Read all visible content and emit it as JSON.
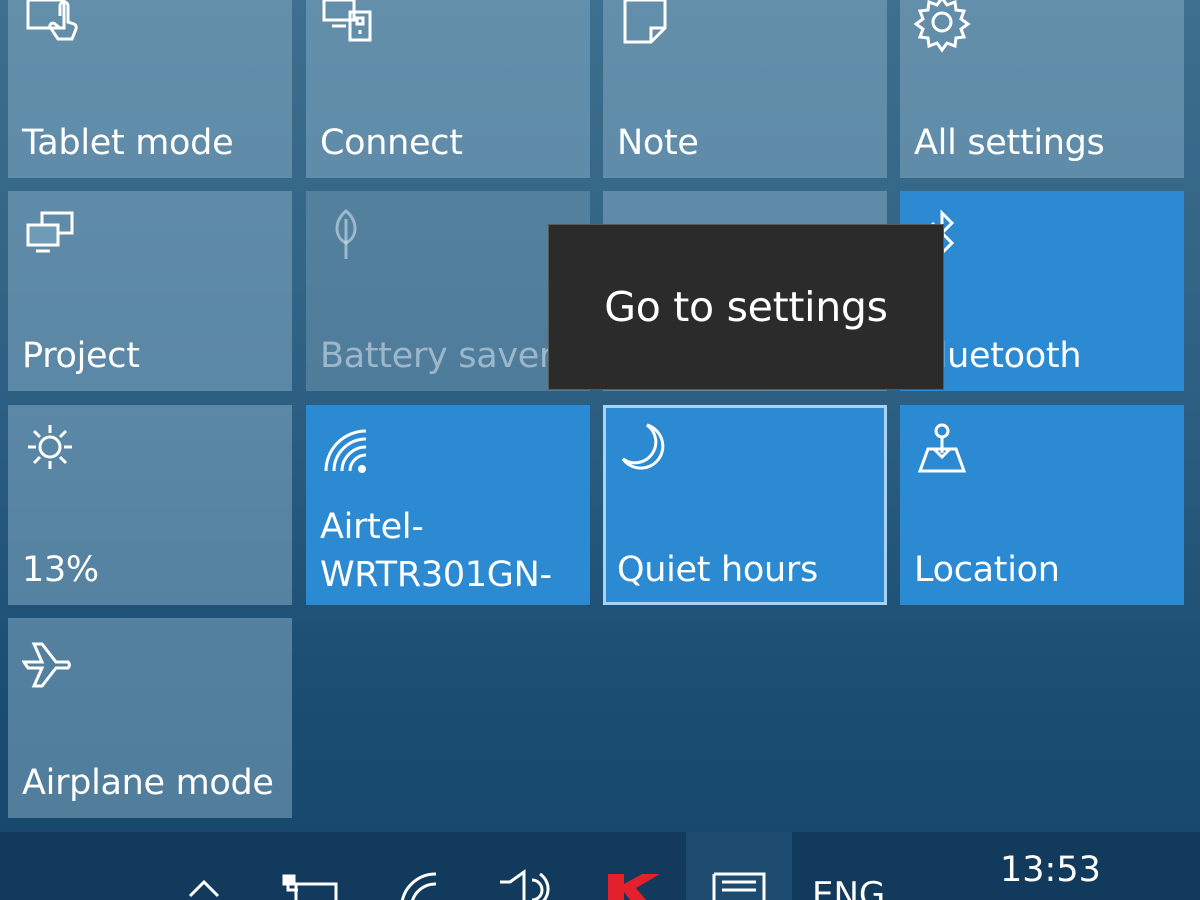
{
  "tiles": {
    "tablet_mode": {
      "label": "Tablet mode",
      "icon": "tablet-mode-icon",
      "state": "off"
    },
    "connect": {
      "label": "Connect",
      "icon": "connect-icon",
      "state": "off"
    },
    "note": {
      "label": "Note",
      "icon": "note-icon",
      "state": "off"
    },
    "all_settings": {
      "label": "All settings",
      "icon": "gear-icon",
      "state": "off"
    },
    "project": {
      "label": "Project",
      "icon": "project-icon",
      "state": "off"
    },
    "battery_saver": {
      "label": "Battery saver",
      "icon": "leaf-icon",
      "state": "disabled"
    },
    "bluetooth": {
      "label": "Bluetooth",
      "icon": "bluetooth-icon",
      "state": "on"
    },
    "brightness": {
      "label": "13%",
      "icon": "sun-icon",
      "state": "off"
    },
    "wifi": {
      "label": "Airtel-WRTR301GN-",
      "icon": "wifi-icon",
      "state": "on"
    },
    "quiet_hours": {
      "label": "Quiet hours",
      "icon": "moon-icon",
      "state": "on"
    },
    "location": {
      "label": "Location",
      "icon": "location-icon",
      "state": "on"
    },
    "airplane_mode": {
      "label": "Airplane mode",
      "icon": "airplane-icon",
      "state": "off"
    }
  },
  "tooltip": {
    "text": "Go to settings"
  },
  "taskbar": {
    "language": "ENG",
    "time": "13:53",
    "icons": [
      "chevron-up-icon",
      "battery-icon",
      "network-icon",
      "volume-icon",
      "kaspersky-icon",
      "action-center-icon"
    ]
  },
  "colors": {
    "tile_on": "#2b8ad2",
    "tile_off": "#6f9bb6",
    "tooltip_bg": "#2b2b2b",
    "taskbar_bg": "#113a5c",
    "kaspersky_red": "#e4202c"
  }
}
